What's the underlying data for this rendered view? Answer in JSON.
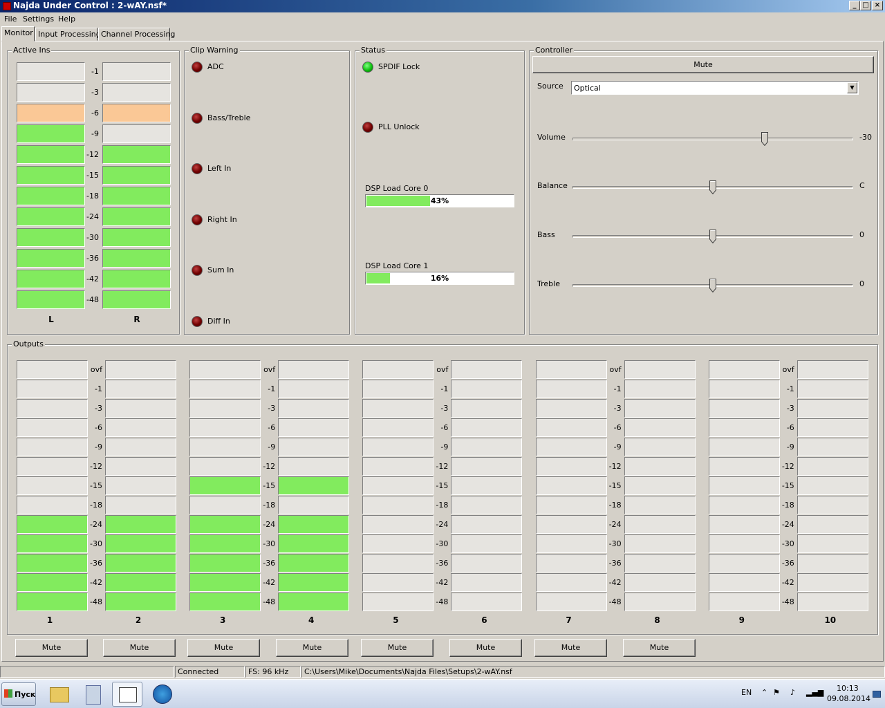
{
  "window": {
    "title": "Najda Under Control : 2-wAY.nsf*",
    "buttons": [
      "_",
      "□",
      "×"
    ]
  },
  "menu": [
    "File",
    "Settings",
    "Help"
  ],
  "tabs": [
    "Monitor",
    "Input Processing",
    "Channel Processing"
  ],
  "active_ins": {
    "title": "Active Ins",
    "scale": [
      "-1",
      "-3",
      "-6",
      "-9",
      "-12",
      "-15",
      "-18",
      "-24",
      "-30",
      "-36",
      "-42",
      "-48"
    ],
    "channels": [
      {
        "label": "L",
        "states": [
          "off",
          "off",
          "warn",
          "on",
          "on",
          "on",
          "on",
          "on",
          "on",
          "on",
          "on",
          "on"
        ]
      },
      {
        "label": "R",
        "states": [
          "off",
          "off",
          "warn",
          "off",
          "on",
          "on",
          "on",
          "on",
          "on",
          "on",
          "on",
          "on"
        ]
      }
    ]
  },
  "clip_warning": {
    "title": "Clip Warning",
    "items": [
      "ADC",
      "Bass/Treble",
      "Left In",
      "Right In",
      "Sum In",
      "Diff In"
    ]
  },
  "status": {
    "title": "Status",
    "spdif_label": "SPDIF Lock",
    "pll_label": "PLL Unlock",
    "core0_label": "DSP Load Core 0",
    "core0_text": "43%",
    "core0_value": 43,
    "core1_label": "DSP Load Core 1",
    "core1_text": "16%",
    "core1_value": 16
  },
  "controller": {
    "title": "Controller",
    "mute_label": "Mute",
    "source_label": "Source",
    "source_value": "Optical",
    "sliders": [
      {
        "label": "Volume",
        "value_text": "-30",
        "position": 0.685
      },
      {
        "label": "Balance",
        "value_text": "C",
        "position": 0.5
      },
      {
        "label": "Bass",
        "value_text": "0",
        "position": 0.5
      },
      {
        "label": "Treble",
        "value_text": "0",
        "position": 0.5
      }
    ]
  },
  "outputs": {
    "title": "Outputs",
    "scale": [
      "ovf",
      "-1",
      "-3",
      "-6",
      "-9",
      "-12",
      "-15",
      "-18",
      "-24",
      "-30",
      "-36",
      "-42",
      "-48"
    ],
    "channels": [
      {
        "label": "1",
        "lit_from": 8
      },
      {
        "label": "2",
        "lit_from": 8
      },
      {
        "label": "3",
        "lit_from": 8,
        "extra_lit": [
          6
        ]
      },
      {
        "label": "4",
        "lit_from": 8,
        "extra_lit": [
          6
        ]
      },
      {
        "label": "5",
        "lit_from": 13
      },
      {
        "label": "6",
        "lit_from": 13
      },
      {
        "label": "7",
        "lit_from": 13
      },
      {
        "label": "8",
        "lit_from": 13
      },
      {
        "label": "9",
        "lit_from": 13
      },
      {
        "label": "10",
        "lit_from": 13
      }
    ],
    "mute_label": "Mute",
    "mute_count": 8
  },
  "statusbar": {
    "connection": "Connected",
    "fs": "FS: 96 kHz",
    "path": "C:\\Users\\Mike\\Documents\\Najda Files\\Setups\\2-wAY.nsf"
  },
  "taskbar": {
    "start_label": "Пуск",
    "lang": "EN",
    "time": "10:13",
    "date": "09.08.2014"
  },
  "colors": {
    "meter_on": "#82eb5e",
    "meter_warn": "#fac896",
    "meter_off": "#e6e4e0",
    "led_green": "#10c010",
    "led_red": "#700000"
  }
}
